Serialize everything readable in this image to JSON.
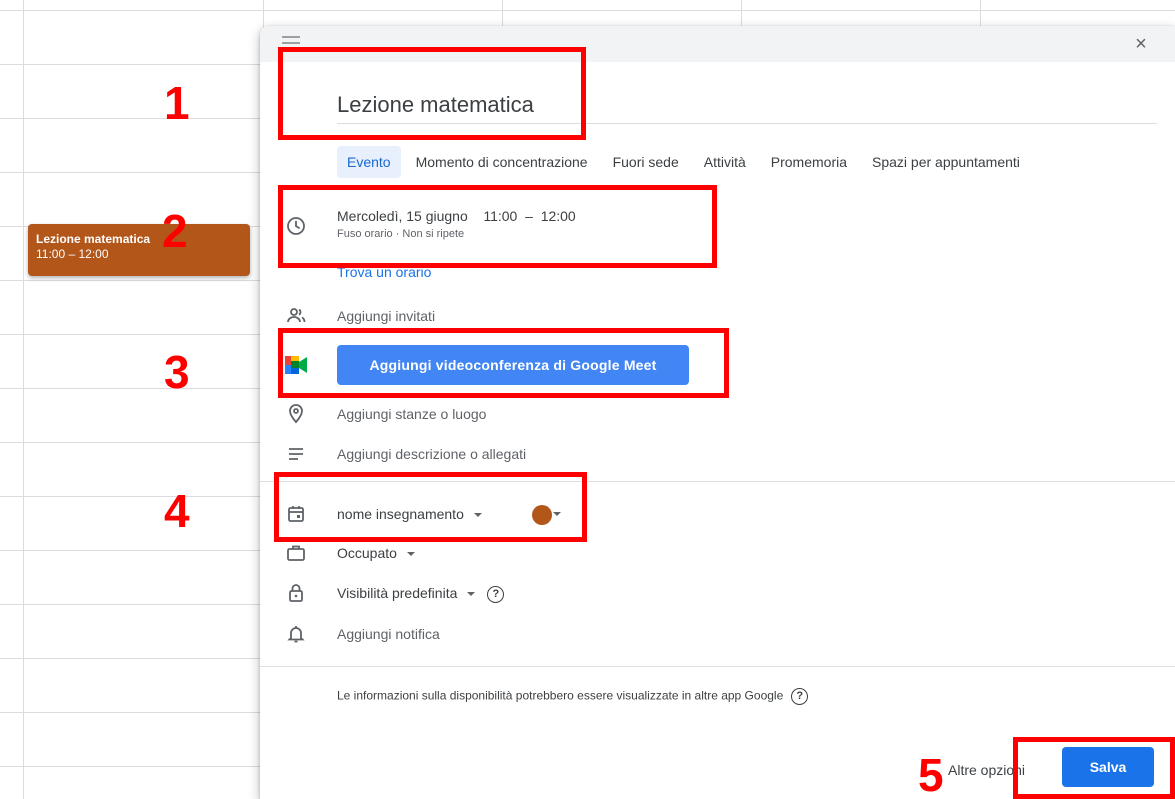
{
  "calendar_event": {
    "title": "Lezione matematica",
    "time": "11:00 – 12:00",
    "color": "#b3561a"
  },
  "dialog": {
    "drag_icon": "drag-handle-icon",
    "close_label": "×",
    "title_value": "Lezione matematica",
    "tabs": [
      {
        "label": "Evento",
        "active": true
      },
      {
        "label": "Momento di concentrazione",
        "active": false
      },
      {
        "label": "Fuori sede",
        "active": false
      },
      {
        "label": "Attività",
        "active": false
      },
      {
        "label": "Promemoria",
        "active": false
      },
      {
        "label": "Spazi per appuntamenti",
        "active": false
      }
    ],
    "when": {
      "date": "Mercoledì, 15 giugno",
      "start": "11:00",
      "separator": "–",
      "end": "12:00",
      "sub": "Fuso orario · Non si ripete"
    },
    "find_time": "Trova un orario",
    "add_guests": "Aggiungi invitati",
    "meet_button": "Aggiungi videoconferenza di Google Meet",
    "add_location": "Aggiungi stanze o luogo",
    "add_description": "Aggiungi descrizione o allegati",
    "calendar_name": "nome insegnamento",
    "event_color": "#b3561a",
    "busy_status": "Occupato",
    "visibility": "Visibilità predefinita",
    "help_glyph": "?",
    "add_notification": "Aggiungi notifica",
    "info_text": "Le informazioni sulla disponibilità potrebbero essere visualizzate in altre app Google",
    "more_options": "Altre opzioni",
    "save": "Salva"
  },
  "annotations": [
    "1",
    "2",
    "3",
    "4",
    "5"
  ],
  "colors": {
    "accent": "#1a73e8",
    "meet_button": "#4285f4",
    "annotation": "#ff0000"
  }
}
